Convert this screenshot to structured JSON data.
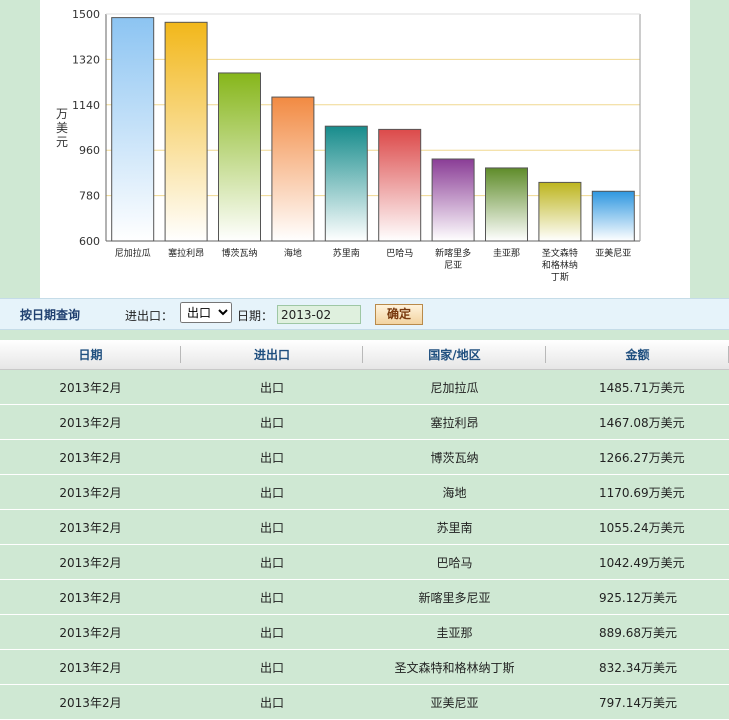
{
  "chart_data": {
    "type": "bar",
    "ylabel": "万美元",
    "ylim": [
      600,
      1500
    ],
    "yticks": [
      600,
      780,
      960,
      1140,
      1320,
      1500
    ],
    "categories": [
      "尼加拉瓜",
      "塞拉利昂",
      "博茨瓦纳",
      "海地",
      "苏里南",
      "巴哈马",
      "新喀里多尼亚",
      "圭亚那",
      "圣文森特和格林纳丁斯",
      "亚美尼亚"
    ],
    "category_lines": [
      [
        "尼加拉瓜"
      ],
      [
        "塞拉利昂"
      ],
      [
        "博茨瓦纳"
      ],
      [
        "海地"
      ],
      [
        "苏里南"
      ],
      [
        "巴哈马"
      ],
      [
        "新喀里多",
        "尼亚"
      ],
      [
        "圭亚那"
      ],
      [
        "圣文森特",
        "和格林纳",
        "丁斯"
      ],
      [
        "亚美尼亚"
      ]
    ],
    "values": [
      1485.71,
      1467.08,
      1266.27,
      1170.69,
      1055.24,
      1042.49,
      925.12,
      889.68,
      832.34,
      797.14
    ],
    "bar_colors": [
      "#8cc4f2",
      "#f2b71a",
      "#86b61a",
      "#f28a42",
      "#178c8c",
      "#dc4a4a",
      "#8a3d96",
      "#5f8c2a",
      "#bdb51e",
      "#2e97e0"
    ],
    "gridlines": true
  },
  "query": {
    "title": "按日期查询",
    "direction_label": "进出口：",
    "direction_value": "出口",
    "direction_options": [
      "出口"
    ],
    "date_label": "日期：",
    "date_value": "2013-02",
    "confirm_label": "确定"
  },
  "table": {
    "headers": [
      "日期",
      "进出口",
      "国家/地区",
      "金额"
    ],
    "rows": [
      [
        "2013年2月",
        "出口",
        "尼加拉瓜",
        "1485.71万美元"
      ],
      [
        "2013年2月",
        "出口",
        "塞拉利昂",
        "1467.08万美元"
      ],
      [
        "2013年2月",
        "出口",
        "博茨瓦纳",
        "1266.27万美元"
      ],
      [
        "2013年2月",
        "出口",
        "海地",
        "1170.69万美元"
      ],
      [
        "2013年2月",
        "出口",
        "苏里南",
        "1055.24万美元"
      ],
      [
        "2013年2月",
        "出口",
        "巴哈马",
        "1042.49万美元"
      ],
      [
        "2013年2月",
        "出口",
        "新喀里多尼亚",
        "925.12万美元"
      ],
      [
        "2013年2月",
        "出口",
        "圭亚那",
        "889.68万美元"
      ],
      [
        "2013年2月",
        "出口",
        "圣文森特和格林纳丁斯",
        "832.34万美元"
      ],
      [
        "2013年2月",
        "出口",
        "亚美尼亚",
        "797.14万美元"
      ]
    ]
  }
}
